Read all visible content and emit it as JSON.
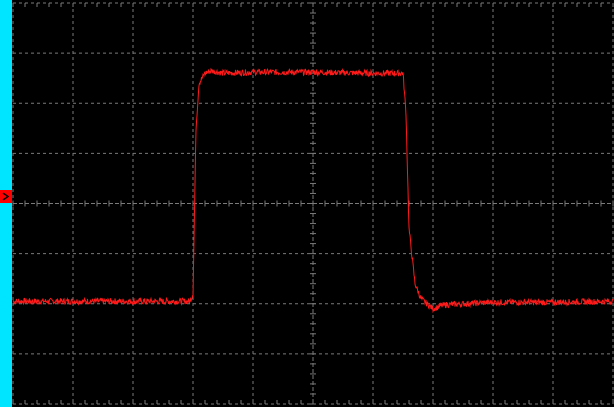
{
  "display": {
    "background_color": "#000000",
    "grid_color": "#7a7a7a",
    "trace_color": "#ff1a1a",
    "left_strip_color": "#00e5ff",
    "trigger_marker_color": "#ff0000",
    "grid_divisions": {
      "horizontal": 10,
      "vertical": 8
    },
    "minor_ticks_per_division": 5
  },
  "trigger_marker": {
    "icon": "chevron-right-icon",
    "label": ">"
  },
  "chart_data": {
    "type": "line",
    "title": "",
    "xlabel": "",
    "ylabel": "",
    "xlim": [
      0,
      10
    ],
    "ylim": [
      -4,
      4
    ],
    "grid": true,
    "series": [
      {
        "color": "#ff1a1a",
        "x": [
          0,
          2.95,
          3.0,
          3.05,
          3.1,
          3.2,
          3.3,
          3.5,
          4.0,
          5.0,
          6.0,
          6.5,
          6.55,
          6.6,
          6.7,
          6.8,
          6.9,
          7.0,
          7.2,
          8.0,
          9.0,
          10.0
        ],
        "y": [
          -1.95,
          -1.95,
          -1.8,
          1.5,
          2.4,
          2.6,
          2.65,
          2.6,
          2.62,
          2.62,
          2.6,
          2.6,
          1.8,
          -0.5,
          -1.6,
          -1.9,
          -2.0,
          -2.1,
          -2.02,
          -1.97,
          -1.97,
          -1.95
        ]
      }
    ]
  }
}
